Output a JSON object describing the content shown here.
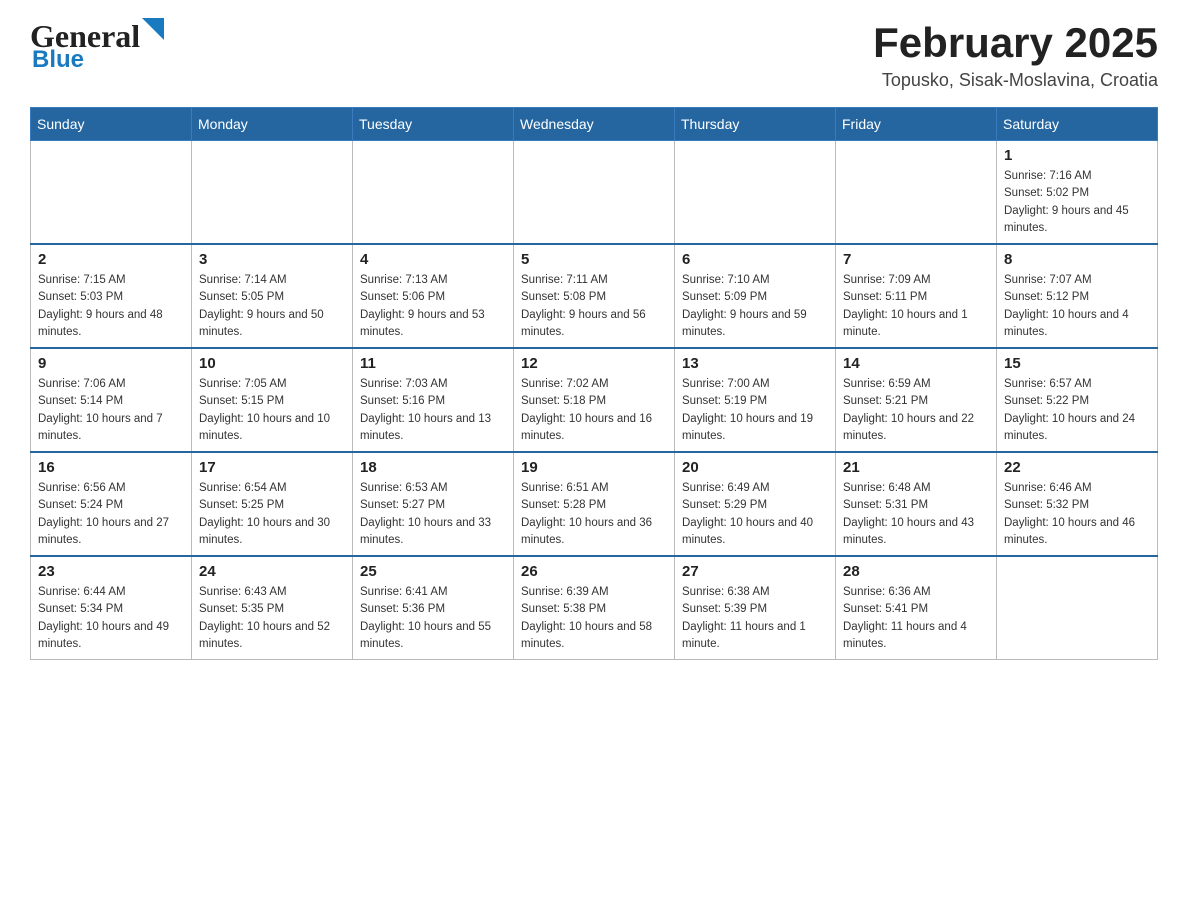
{
  "header": {
    "logo_general": "General",
    "logo_blue": "Blue",
    "title": "February 2025",
    "subtitle": "Topusko, Sisak-Moslavina, Croatia"
  },
  "calendar": {
    "days_of_week": [
      "Sunday",
      "Monday",
      "Tuesday",
      "Wednesday",
      "Thursday",
      "Friday",
      "Saturday"
    ],
    "weeks": [
      [
        {
          "day": "",
          "info": ""
        },
        {
          "day": "",
          "info": ""
        },
        {
          "day": "",
          "info": ""
        },
        {
          "day": "",
          "info": ""
        },
        {
          "day": "",
          "info": ""
        },
        {
          "day": "",
          "info": ""
        },
        {
          "day": "1",
          "info": "Sunrise: 7:16 AM\nSunset: 5:02 PM\nDaylight: 9 hours and 45 minutes."
        }
      ],
      [
        {
          "day": "2",
          "info": "Sunrise: 7:15 AM\nSunset: 5:03 PM\nDaylight: 9 hours and 48 minutes."
        },
        {
          "day": "3",
          "info": "Sunrise: 7:14 AM\nSunset: 5:05 PM\nDaylight: 9 hours and 50 minutes."
        },
        {
          "day": "4",
          "info": "Sunrise: 7:13 AM\nSunset: 5:06 PM\nDaylight: 9 hours and 53 minutes."
        },
        {
          "day": "5",
          "info": "Sunrise: 7:11 AM\nSunset: 5:08 PM\nDaylight: 9 hours and 56 minutes."
        },
        {
          "day": "6",
          "info": "Sunrise: 7:10 AM\nSunset: 5:09 PM\nDaylight: 9 hours and 59 minutes."
        },
        {
          "day": "7",
          "info": "Sunrise: 7:09 AM\nSunset: 5:11 PM\nDaylight: 10 hours and 1 minute."
        },
        {
          "day": "8",
          "info": "Sunrise: 7:07 AM\nSunset: 5:12 PM\nDaylight: 10 hours and 4 minutes."
        }
      ],
      [
        {
          "day": "9",
          "info": "Sunrise: 7:06 AM\nSunset: 5:14 PM\nDaylight: 10 hours and 7 minutes."
        },
        {
          "day": "10",
          "info": "Sunrise: 7:05 AM\nSunset: 5:15 PM\nDaylight: 10 hours and 10 minutes."
        },
        {
          "day": "11",
          "info": "Sunrise: 7:03 AM\nSunset: 5:16 PM\nDaylight: 10 hours and 13 minutes."
        },
        {
          "day": "12",
          "info": "Sunrise: 7:02 AM\nSunset: 5:18 PM\nDaylight: 10 hours and 16 minutes."
        },
        {
          "day": "13",
          "info": "Sunrise: 7:00 AM\nSunset: 5:19 PM\nDaylight: 10 hours and 19 minutes."
        },
        {
          "day": "14",
          "info": "Sunrise: 6:59 AM\nSunset: 5:21 PM\nDaylight: 10 hours and 22 minutes."
        },
        {
          "day": "15",
          "info": "Sunrise: 6:57 AM\nSunset: 5:22 PM\nDaylight: 10 hours and 24 minutes."
        }
      ],
      [
        {
          "day": "16",
          "info": "Sunrise: 6:56 AM\nSunset: 5:24 PM\nDaylight: 10 hours and 27 minutes."
        },
        {
          "day": "17",
          "info": "Sunrise: 6:54 AM\nSunset: 5:25 PM\nDaylight: 10 hours and 30 minutes."
        },
        {
          "day": "18",
          "info": "Sunrise: 6:53 AM\nSunset: 5:27 PM\nDaylight: 10 hours and 33 minutes."
        },
        {
          "day": "19",
          "info": "Sunrise: 6:51 AM\nSunset: 5:28 PM\nDaylight: 10 hours and 36 minutes."
        },
        {
          "day": "20",
          "info": "Sunrise: 6:49 AM\nSunset: 5:29 PM\nDaylight: 10 hours and 40 minutes."
        },
        {
          "day": "21",
          "info": "Sunrise: 6:48 AM\nSunset: 5:31 PM\nDaylight: 10 hours and 43 minutes."
        },
        {
          "day": "22",
          "info": "Sunrise: 6:46 AM\nSunset: 5:32 PM\nDaylight: 10 hours and 46 minutes."
        }
      ],
      [
        {
          "day": "23",
          "info": "Sunrise: 6:44 AM\nSunset: 5:34 PM\nDaylight: 10 hours and 49 minutes."
        },
        {
          "day": "24",
          "info": "Sunrise: 6:43 AM\nSunset: 5:35 PM\nDaylight: 10 hours and 52 minutes."
        },
        {
          "day": "25",
          "info": "Sunrise: 6:41 AM\nSunset: 5:36 PM\nDaylight: 10 hours and 55 minutes."
        },
        {
          "day": "26",
          "info": "Sunrise: 6:39 AM\nSunset: 5:38 PM\nDaylight: 10 hours and 58 minutes."
        },
        {
          "day": "27",
          "info": "Sunrise: 6:38 AM\nSunset: 5:39 PM\nDaylight: 11 hours and 1 minute."
        },
        {
          "day": "28",
          "info": "Sunrise: 6:36 AM\nSunset: 5:41 PM\nDaylight: 11 hours and 4 minutes."
        },
        {
          "day": "",
          "info": ""
        }
      ]
    ]
  }
}
